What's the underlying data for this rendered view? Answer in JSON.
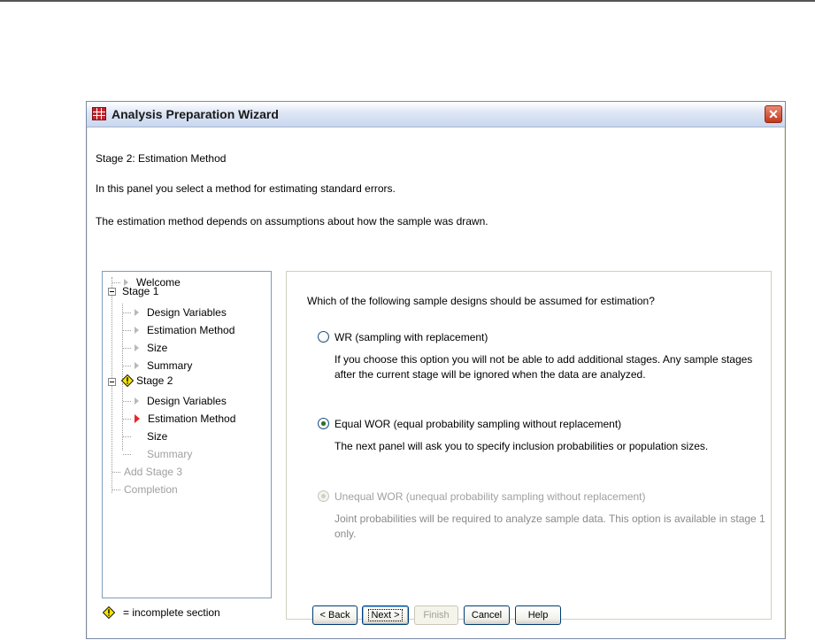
{
  "window": {
    "title": "Analysis Preparation Wizard",
    "close_glyph": "✕",
    "app_icon": "grid-icon"
  },
  "header": {
    "stage_title": "Stage 2: Estimation Method",
    "intro_line1": "In this panel you select a method for estimating standard errors.",
    "intro_line2": "The estimation method depends on assumptions about how the sample was drawn."
  },
  "tree": {
    "items": [
      {
        "label": "Welcome"
      },
      {
        "label": "Stage 1"
      },
      {
        "label": "Design Variables"
      },
      {
        "label": "Estimation Method"
      },
      {
        "label": "Size"
      },
      {
        "label": "Summary"
      },
      {
        "label": "Stage 2"
      },
      {
        "label": "Design Variables"
      },
      {
        "label": "Estimation Method"
      },
      {
        "label": "Size"
      },
      {
        "label": "Summary"
      },
      {
        "label": "Add Stage 3"
      },
      {
        "label": "Completion"
      }
    ]
  },
  "legend": {
    "label": "= incomplete section",
    "icon": "warning-icon"
  },
  "content": {
    "question": "Which of the following sample designs should be assumed for estimation?",
    "options": [
      {
        "label": "WR (sampling with replacement)",
        "selected": false,
        "enabled": true,
        "description": "If you choose this option you will not be able to add additional stages. Any sample stages after the current stage will be ignored when the data are analyzed."
      },
      {
        "label": "Equal WOR (equal probability sampling without replacement)",
        "selected": true,
        "enabled": true,
        "description": "The next panel will ask you to specify inclusion probabilities or population sizes."
      },
      {
        "label": "Unequal WOR (unequal probability sampling without replacement)",
        "selected": false,
        "enabled": false,
        "description": "Joint probabilities will be required to analyze sample data. This option is available in stage 1 only."
      }
    ]
  },
  "buttons": {
    "back": "< Back",
    "next": "Next >",
    "finish": "Finish",
    "cancel": "Cancel",
    "help": "Help"
  },
  "colors": {
    "active_arrow": "#e8242b",
    "warning": "#f5e400",
    "selected_radio": "#2f6e2f"
  }
}
